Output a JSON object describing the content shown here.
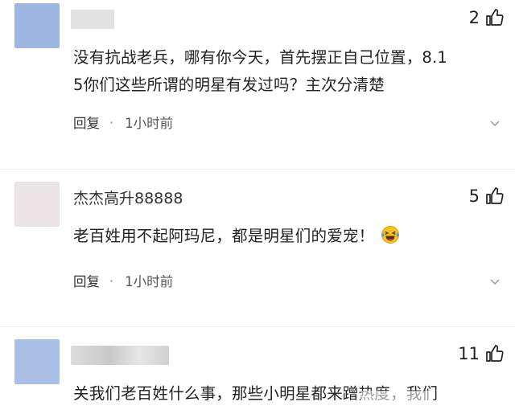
{
  "comments": [
    {
      "username": "",
      "avatar_color": "#9fb5e1",
      "likes": "2",
      "text_line1": "没有抗战老兵，哪有你今天，首先摆正自己位置，8.1",
      "text_line2": "5你们这些所谓的明星有发过吗？主次分清楚",
      "reply_label": "回复",
      "separator": "·",
      "time": "1小时前"
    },
    {
      "username": "杰杰高升88888",
      "avatar_color": "#e9dfe3",
      "likes": "5",
      "text_line1": "老百姓用不起阿玛尼，都是明星们的爱宠！",
      "emoji": "laughing-tears-emoji",
      "reply_label": "回复",
      "separator": "·",
      "time": "1小时前"
    },
    {
      "username": "",
      "avatar_color": "#a9bde4",
      "likes": "11",
      "text_line1": "关我们老百姓什么事，那些小明星都来蹭热度，我们"
    }
  ],
  "icons": {
    "like": "thumbs-up-icon",
    "collapse": "chevron-down-icon"
  },
  "colors": {
    "text": "#222222",
    "meta": "#555555",
    "blurred_name": "#d6d6d6"
  }
}
